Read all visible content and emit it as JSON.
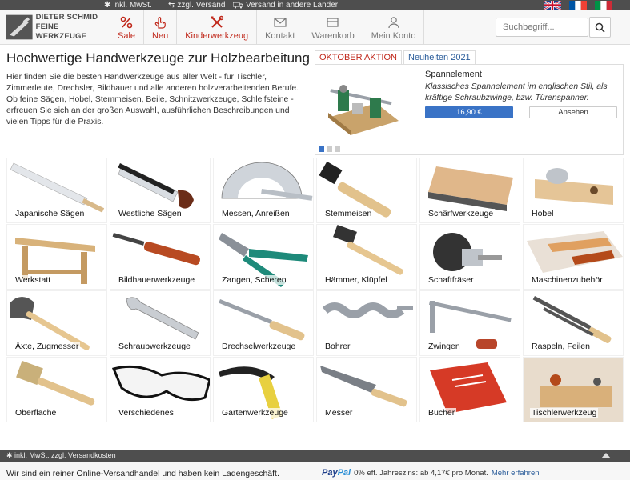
{
  "topbar": {
    "items": [
      "inkl. MwSt.",
      "zzgl. Versand",
      "Versand in andere Länder"
    ],
    "colors": {
      "bar": "#4e4e4e"
    }
  },
  "logo": {
    "line1": "DIETER SCHMID",
    "line2": "FEINE WERKZEUGE"
  },
  "nav": [
    {
      "label": "Sale",
      "icon": "percent-icon",
      "color": "#c0281b"
    },
    {
      "label": "Neu",
      "icon": "hand-pointer-icon",
      "color": "#c0281b"
    },
    {
      "label": "Kinderwerkzeug",
      "icon": "tools-icon",
      "color": "#c0281b"
    },
    {
      "label": "Kontakt",
      "icon": "envelope-icon",
      "color": "#777777"
    },
    {
      "label": "Warenkorb",
      "icon": "cart-icon",
      "color": "#777777"
    },
    {
      "label": "Mein Konto",
      "icon": "user-icon",
      "color": "#777777"
    }
  ],
  "search": {
    "placeholder": "Suchbegriff..."
  },
  "intro": {
    "title": "Hochwertige Handwerkzeuge zur Holzbearbeitung",
    "text": "Hier finden Sie die besten Handwerkzeuge aus aller Welt - für Tischler, Zimmerleute, Drechsler, Bildhauer und alle anderen holzverarbeitenden Berufe. Ob feine Sägen, Hobel, Stemmeisen, Beile, Schnitzwerkzeuge, Schleifsteine - erfreuen Sie sich an der großen Auswahl, ausführlichen Beschreibungen und vielen Tipps für die Praxis."
  },
  "promo": {
    "tabs": [
      "OKTOBER AKTION",
      "Neuheiten 2021"
    ],
    "title": "Spannelement",
    "description": "Klassisches Spannelement im englischen Stil, als kräftige Schraubzwinge, bzw. Türenspanner.",
    "price": "16,90 €",
    "view": "Ansehen",
    "slide_count": 3,
    "accent": "#3a73c6"
  },
  "categories": [
    "Japanische Sägen",
    "Westliche Sägen",
    "Messen, Anreißen",
    "Stemmeisen",
    "Schärfwerkzeuge",
    "Hobel",
    "Werkstatt",
    "Bildhauerwerkzeuge",
    "Zangen, Scheren",
    "Hämmer, Klüpfel",
    "Schaftfräser",
    "Maschinenzubehör",
    "Äxte, Zugmesser",
    "Schraubwerkzeuge",
    "Drechselwerkzeuge",
    "Bohrer",
    "Zwingen",
    "Raspeln, Feilen",
    "Oberfläche",
    "Verschiedenes",
    "Gartenwerkzeuge",
    "Messer",
    "Bücher",
    "Tischlerwerkzeug"
  ],
  "footer": {
    "bar_text": "inkl. MwSt. zzgl. Versandkosten",
    "notice": "Wir sind ein reiner Online-Versandhandel und haben kein Ladengeschäft.",
    "paypal": {
      "brand_a": "Pay",
      "brand_b": "Pal",
      "text": "0% eff. Jahreszins: ab 4,17€ pro Monat.",
      "link": "Mehr erfahren"
    }
  }
}
